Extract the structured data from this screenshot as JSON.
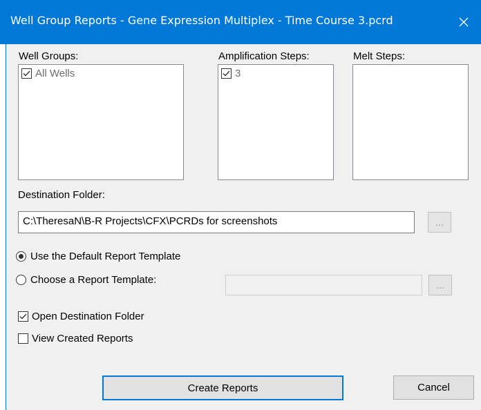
{
  "window": {
    "title": "Well Group Reports - Gene Expression Multiplex - Time Course 3.pcrd",
    "close_glyph": "✕"
  },
  "well_groups": {
    "label": "Well Groups:",
    "items": [
      {
        "label": "All Wells",
        "checked": true
      }
    ]
  },
  "amplification_steps": {
    "label": "Amplification Steps:",
    "items": [
      {
        "label": "3",
        "checked": true
      }
    ]
  },
  "melt_steps": {
    "label": "Melt Steps:",
    "items": []
  },
  "destination": {
    "label": "Destination Folder:",
    "value": "C:\\TheresaN\\B-R Projects\\CFX\\PCRDs for screenshots",
    "browse_label": "..."
  },
  "template": {
    "default_label": "Use the Default Report Template",
    "choose_label": "Choose a Report Template:",
    "selected": "default",
    "path_value": "",
    "browse_label": "..."
  },
  "options": {
    "open_folder_label": "Open Destination Folder",
    "open_folder_checked": true,
    "view_reports_label": "View Created Reports",
    "view_reports_checked": false
  },
  "buttons": {
    "create_label": "Create Reports",
    "cancel_label": "Cancel"
  },
  "colors": {
    "titlebar": "#0078d7",
    "dialog_bg": "#f0f0f0"
  }
}
